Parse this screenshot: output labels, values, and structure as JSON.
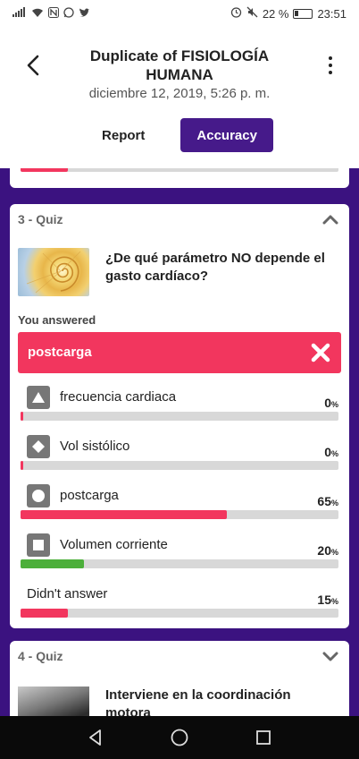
{
  "status_bar": {
    "signal_text": ".ıll",
    "battery_percent": "22 %",
    "time": "23:51",
    "icons": [
      "signal-icon",
      "wifi-icon",
      "nfc-icon",
      "whatsapp-icon",
      "twitter-icon",
      "alarm-icon",
      "mute-icon",
      "battery-icon"
    ]
  },
  "header": {
    "title": "Duplicate of FISIOLOGÍA HUMANA",
    "subtitle": "diciembre 12, 2019, 5:26 p. m.",
    "tabs": [
      {
        "label": "Report",
        "active": false
      },
      {
        "label": "Accuracy",
        "active": true
      }
    ]
  },
  "previous_card": {
    "progress_percent": 15
  },
  "quiz3": {
    "heading": "3 - Quiz",
    "question": "¿De qué parámetro NO depende el gasto cardíaco?",
    "answered_label": "You answered",
    "answer": "postcarga",
    "answer_correct": false,
    "options": [
      {
        "icon": "triangle-icon",
        "label": "frecuencia cardiaca",
        "percent_num": "0",
        "percent": 0,
        "color": "#f2365e"
      },
      {
        "icon": "diamond-icon",
        "label": "Vol sistólico",
        "percent_num": "0",
        "percent": 0,
        "color": "#f2365e"
      },
      {
        "icon": "circle-icon",
        "label": "postcarga",
        "percent_num": "65",
        "percent": 65,
        "color": "#f2365e"
      },
      {
        "icon": "square-icon",
        "label": "Volumen corriente",
        "percent_num": "20",
        "percent": 20,
        "color": "#4caf3a"
      }
    ],
    "didnt_answer": {
      "label": "Didn't answer",
      "percent_num": "15",
      "percent": 15,
      "color": "#f2365e"
    },
    "percent_sign": "%"
  },
  "quiz4": {
    "heading": "4 - Quiz",
    "question": "Interviene en la coordinación motora"
  },
  "colors": {
    "accent_purple": "#461a8a",
    "background_purple": "#3b1280",
    "incorrect_red": "#f2365e",
    "correct_green": "#4caf3a"
  }
}
